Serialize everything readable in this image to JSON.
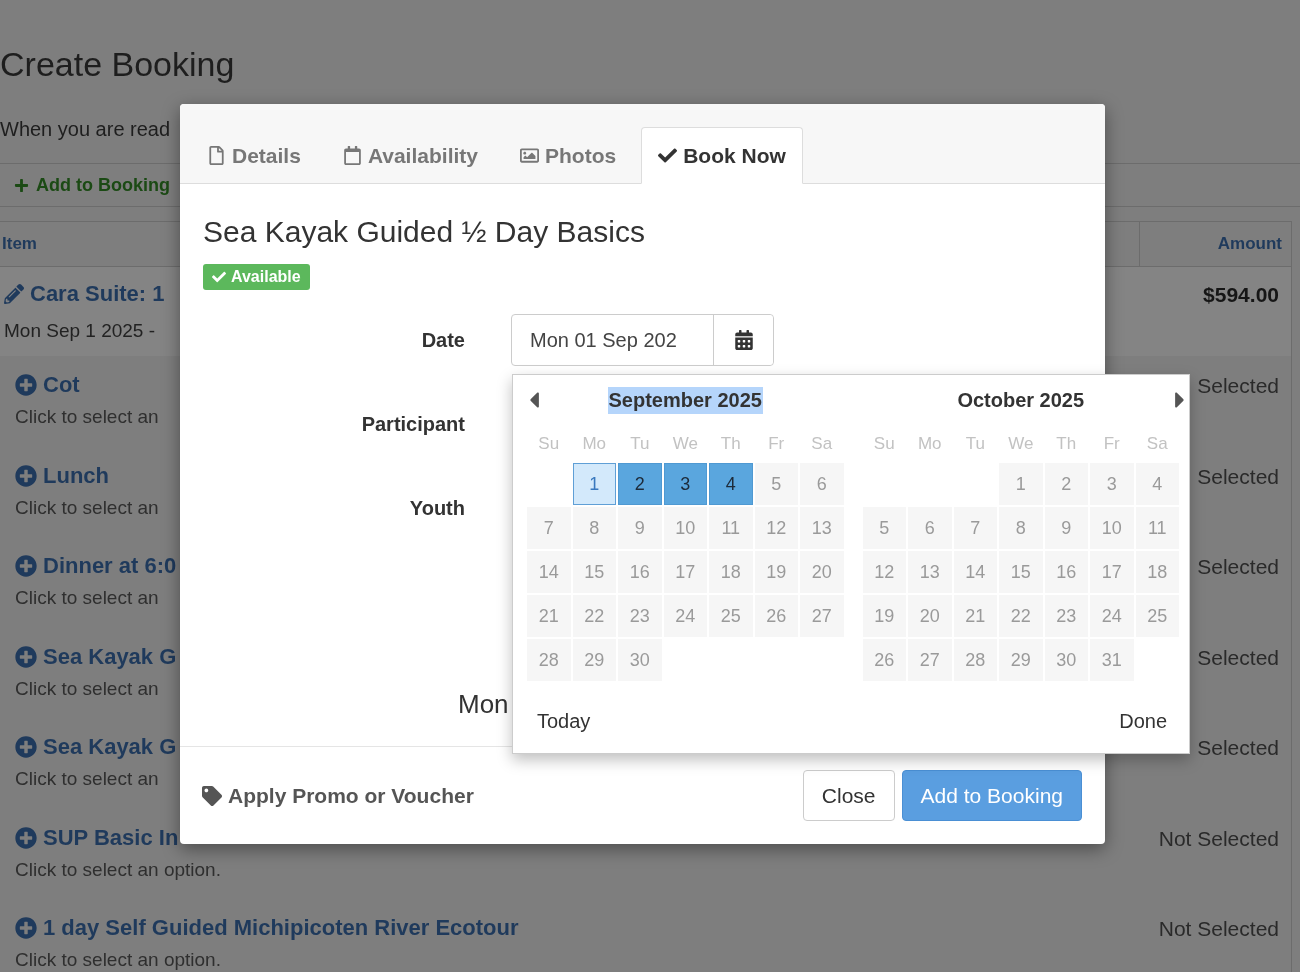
{
  "page": {
    "title": "Create Booking",
    "intro": "When you are read",
    "add_link": "Add to Booking",
    "table": {
      "columns": [
        "Item",
        "Amount"
      ],
      "booked_item": {
        "name": "Cara Suite: 1",
        "dates": "Mon Sep 1 2025 -",
        "amount": "$594.00"
      },
      "options": [
        {
          "name": "Cot",
          "hint": "Click to select an",
          "status": "Selected"
        },
        {
          "name": "Lunch",
          "hint": "Click to select an",
          "status": "Selected"
        },
        {
          "name": "Dinner at 6:0",
          "hint": "Click to select an",
          "status": "Selected"
        },
        {
          "name": "Sea Kayak G",
          "hint": "Click to select an",
          "status": "Selected"
        },
        {
          "name": "Sea Kayak G",
          "hint": "Click to select an",
          "status": "Selected"
        },
        {
          "name": "SUP Basic In",
          "hint": "Click to select an option.",
          "status": "Not Selected"
        },
        {
          "name": "1 day Self Guided Michipicoten River Ecotour",
          "hint": "Click to select an option.",
          "status": "Not Selected"
        }
      ]
    }
  },
  "modal": {
    "tabs": [
      {
        "label": "Details",
        "kind": "file",
        "selected": false
      },
      {
        "label": "Availability",
        "kind": "calendar",
        "selected": false
      },
      {
        "label": "Photos",
        "kind": "image",
        "selected": false
      },
      {
        "label": "Book Now",
        "kind": "check",
        "selected": true
      }
    ],
    "title": "Sea Kayak Guided ½ Day Basics",
    "badge": "Available",
    "form": [
      {
        "label": "Date",
        "kind": "date",
        "value": "Mon 01 Sep 202"
      },
      {
        "label": "Participant",
        "kind": "hidden"
      },
      {
        "label": "Youth",
        "kind": "hidden"
      }
    ],
    "note": "Mon",
    "footer": {
      "promo": "Apply Promo or Voucher",
      "buttons": [
        {
          "label": "Close",
          "kind": "default"
        },
        {
          "label": "Add to Booking",
          "kind": "primary"
        }
      ]
    },
    "calendar": {
      "months": [
        {
          "title": "September 2025",
          "highlighted": true,
          "weekdays": [
            "Su",
            "Mo",
            "Tu",
            "We",
            "Th",
            "Fr",
            "Sa"
          ],
          "days": [
            {
              "kind": "blank"
            },
            {
              "kind": "day",
              "label": "1",
              "selected": true,
              "in_range": false
            },
            {
              "kind": "day",
              "label": "2",
              "selected": false,
              "in_range": true
            },
            {
              "kind": "day",
              "label": "3",
              "selected": false,
              "in_range": true
            },
            {
              "kind": "day",
              "label": "4",
              "selected": false,
              "in_range": true
            },
            {
              "kind": "day",
              "label": "5",
              "selected": false,
              "in_range": false
            },
            {
              "kind": "day",
              "label": "6",
              "selected": false,
              "in_range": false
            },
            {
              "kind": "day",
              "label": "7",
              "selected": false,
              "in_range": false
            },
            {
              "kind": "day",
              "label": "8",
              "selected": false,
              "in_range": false
            },
            {
              "kind": "day",
              "label": "9",
              "selected": false,
              "in_range": false
            },
            {
              "kind": "day",
              "label": "10",
              "selected": false,
              "in_range": false
            },
            {
              "kind": "day",
              "label": "11",
              "selected": false,
              "in_range": false
            },
            {
              "kind": "day",
              "label": "12",
              "selected": false,
              "in_range": false
            },
            {
              "kind": "day",
              "label": "13",
              "selected": false,
              "in_range": false
            },
            {
              "kind": "day",
              "label": "14",
              "selected": false,
              "in_range": false
            },
            {
              "kind": "day",
              "label": "15",
              "selected": false,
              "in_range": false
            },
            {
              "kind": "day",
              "label": "16",
              "selected": false,
              "in_range": false
            },
            {
              "kind": "day",
              "label": "17",
              "selected": false,
              "in_range": false
            },
            {
              "kind": "day",
              "label": "18",
              "selected": false,
              "in_range": false
            },
            {
              "kind": "day",
              "label": "19",
              "selected": false,
              "in_range": false
            },
            {
              "kind": "day",
              "label": "20",
              "selected": false,
              "in_range": false
            },
            {
              "kind": "day",
              "label": "21",
              "selected": false,
              "in_range": false
            },
            {
              "kind": "day",
              "label": "22",
              "selected": false,
              "in_range": false
            },
            {
              "kind": "day",
              "label": "23",
              "selected": false,
              "in_range": false
            },
            {
              "kind": "day",
              "label": "24",
              "selected": false,
              "in_range": false
            },
            {
              "kind": "day",
              "label": "25",
              "selected": false,
              "in_range": false
            },
            {
              "kind": "day",
              "label": "26",
              "selected": false,
              "in_range": false
            },
            {
              "kind": "day",
              "label": "27",
              "selected": false,
              "in_range": false
            },
            {
              "kind": "day",
              "label": "28",
              "selected": false,
              "in_range": false
            },
            {
              "kind": "day",
              "label": "29",
              "selected": false,
              "in_range": false
            },
            {
              "kind": "day",
              "label": "30",
              "selected": false,
              "in_range": false
            }
          ]
        },
        {
          "title": "October 2025",
          "highlighted": false,
          "weekdays": [
            "Su",
            "Mo",
            "Tu",
            "We",
            "Th",
            "Fr",
            "Sa"
          ],
          "days": [
            {
              "kind": "blank"
            },
            {
              "kind": "blank"
            },
            {
              "kind": "blank"
            },
            {
              "kind": "day",
              "label": "1",
              "selected": false,
              "in_range": false
            },
            {
              "kind": "day",
              "label": "2",
              "selected": false,
              "in_range": false
            },
            {
              "kind": "day",
              "label": "3",
              "selected": false,
              "in_range": false
            },
            {
              "kind": "day",
              "label": "4",
              "selected": false,
              "in_range": false
            },
            {
              "kind": "day",
              "label": "5",
              "selected": false,
              "in_range": false
            },
            {
              "kind": "day",
              "label": "6",
              "selected": false,
              "in_range": false
            },
            {
              "kind": "day",
              "label": "7",
              "selected": false,
              "in_range": false
            },
            {
              "kind": "day",
              "label": "8",
              "selected": false,
              "in_range": false
            },
            {
              "kind": "day",
              "label": "9",
              "selected": false,
              "in_range": false
            },
            {
              "kind": "day",
              "label": "10",
              "selected": false,
              "in_range": false
            },
            {
              "kind": "day",
              "label": "11",
              "selected": false,
              "in_range": false
            },
            {
              "kind": "day",
              "label": "12",
              "selected": false,
              "in_range": false
            },
            {
              "kind": "day",
              "label": "13",
              "selected": false,
              "in_range": false
            },
            {
              "kind": "day",
              "label": "14",
              "selected": false,
              "in_range": false
            },
            {
              "kind": "day",
              "label": "15",
              "selected": false,
              "in_range": false
            },
            {
              "kind": "day",
              "label": "16",
              "selected": false,
              "in_range": false
            },
            {
              "kind": "day",
              "label": "17",
              "selected": false,
              "in_range": false
            },
            {
              "kind": "day",
              "label": "18",
              "selected": false,
              "in_range": false
            },
            {
              "kind": "day",
              "label": "19",
              "selected": false,
              "in_range": false
            },
            {
              "kind": "day",
              "label": "20",
              "selected": false,
              "in_range": false
            },
            {
              "kind": "day",
              "label": "21",
              "selected": false,
              "in_range": false
            },
            {
              "kind": "day",
              "label": "22",
              "selected": false,
              "in_range": false
            },
            {
              "kind": "day",
              "label": "23",
              "selected": false,
              "in_range": false
            },
            {
              "kind": "day",
              "label": "24",
              "selected": false,
              "in_range": false
            },
            {
              "kind": "day",
              "label": "25",
              "selected": false,
              "in_range": false
            },
            {
              "kind": "day",
              "label": "26",
              "selected": false,
              "in_range": false
            },
            {
              "kind": "day",
              "label": "27",
              "selected": false,
              "in_range": false
            },
            {
              "kind": "day",
              "label": "28",
              "selected": false,
              "in_range": false
            },
            {
              "kind": "day",
              "label": "29",
              "selected": false,
              "in_range": false
            },
            {
              "kind": "day",
              "label": "30",
              "selected": false,
              "in_range": false
            },
            {
              "kind": "day",
              "label": "31",
              "selected": false,
              "in_range": false
            }
          ]
        }
      ],
      "today": "Today",
      "done": "Done"
    }
  }
}
